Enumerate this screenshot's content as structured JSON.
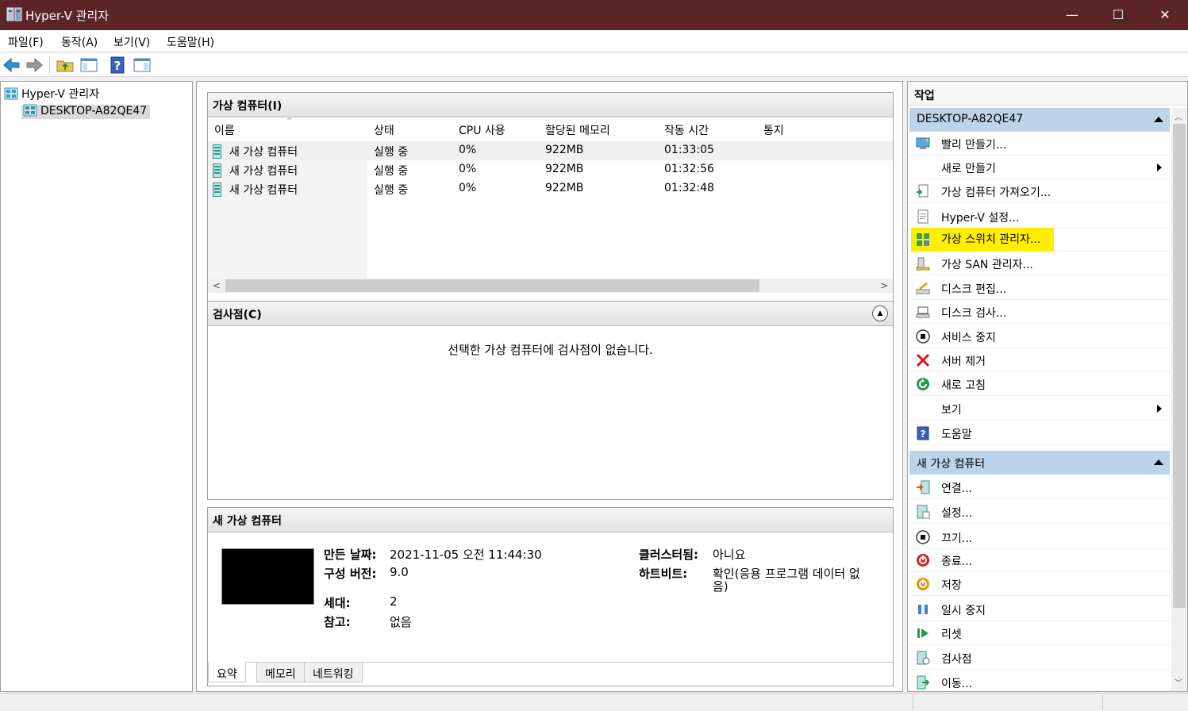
{
  "window": {
    "title": "Hyper-V 관리자",
    "minimize": "—",
    "maximize": "☐",
    "close": "✕"
  },
  "menu": [
    "파일(F)",
    "동작(A)",
    "보기(V)",
    "도움말(H)"
  ],
  "tree": {
    "root": "Hyper-V 관리자",
    "host": "DESKTOP-A82QE47"
  },
  "vm_panel": {
    "title": "가상 컴퓨터(I)",
    "columns": [
      "이름",
      "상태",
      "CPU 사용",
      "할당된 메모리",
      "작동 시간",
      "통지"
    ],
    "rows": [
      {
        "name": "새 가상 컴퓨터",
        "state": "실행 중",
        "cpu": "0%",
        "memory": "922MB",
        "uptime": "01:33:05"
      },
      {
        "name": "새 가상 컴퓨터",
        "state": "실행 중",
        "cpu": "0%",
        "memory": "922MB",
        "uptime": "01:32:56"
      },
      {
        "name": "새 가상 컴퓨터",
        "state": "실행 중",
        "cpu": "0%",
        "memory": "922MB",
        "uptime": "01:32:48"
      }
    ]
  },
  "checkpoint_panel": {
    "title": "검사점(C)",
    "empty": "선택한 가상 컴퓨터에 검사점이 없습니다."
  },
  "detail_panel": {
    "title": "새 가상 컴퓨터",
    "created_label": "만든 날짜:",
    "created": "2021-11-05 오전 11:44:30",
    "version_label": "구성 버전:",
    "version": "9.0",
    "gen_label": "세대:",
    "gen": "2",
    "notes_label": "참고:",
    "notes": "없음",
    "cluster_label": "클러스터됨:",
    "cluster": "아니요",
    "heartbeat_label": "하트비트:",
    "heartbeat_1": "확인(응용 프로그램 데이터 없",
    "heartbeat_2": "음)",
    "tabs": [
      "요약",
      "메모리",
      "네트워킹"
    ]
  },
  "actions": {
    "title": "작업",
    "host_section": "DESKTOP-A82QE47",
    "host_items": [
      "빨리 만들기...",
      "새로 만들기",
      "가상 컴퓨터 가져오기...",
      "Hyper-V 설정...",
      "가상 스위치 관리자...",
      "가상 SAN 관리자...",
      "디스크 편집...",
      "디스크 검사...",
      "서비스 중지",
      "서버 제거",
      "새로 고침",
      "보기",
      "도움말"
    ],
    "vm_section": "새 가상 컴퓨터",
    "vm_items": [
      "연결...",
      "설정...",
      "끄기...",
      "종료...",
      "저장",
      "일시 중지",
      "리셋",
      "검사점",
      "이동..."
    ]
  },
  "colors": {
    "titlebar": "#5b2426",
    "section": "#bcd4ea",
    "highlight": "#ffee00"
  }
}
